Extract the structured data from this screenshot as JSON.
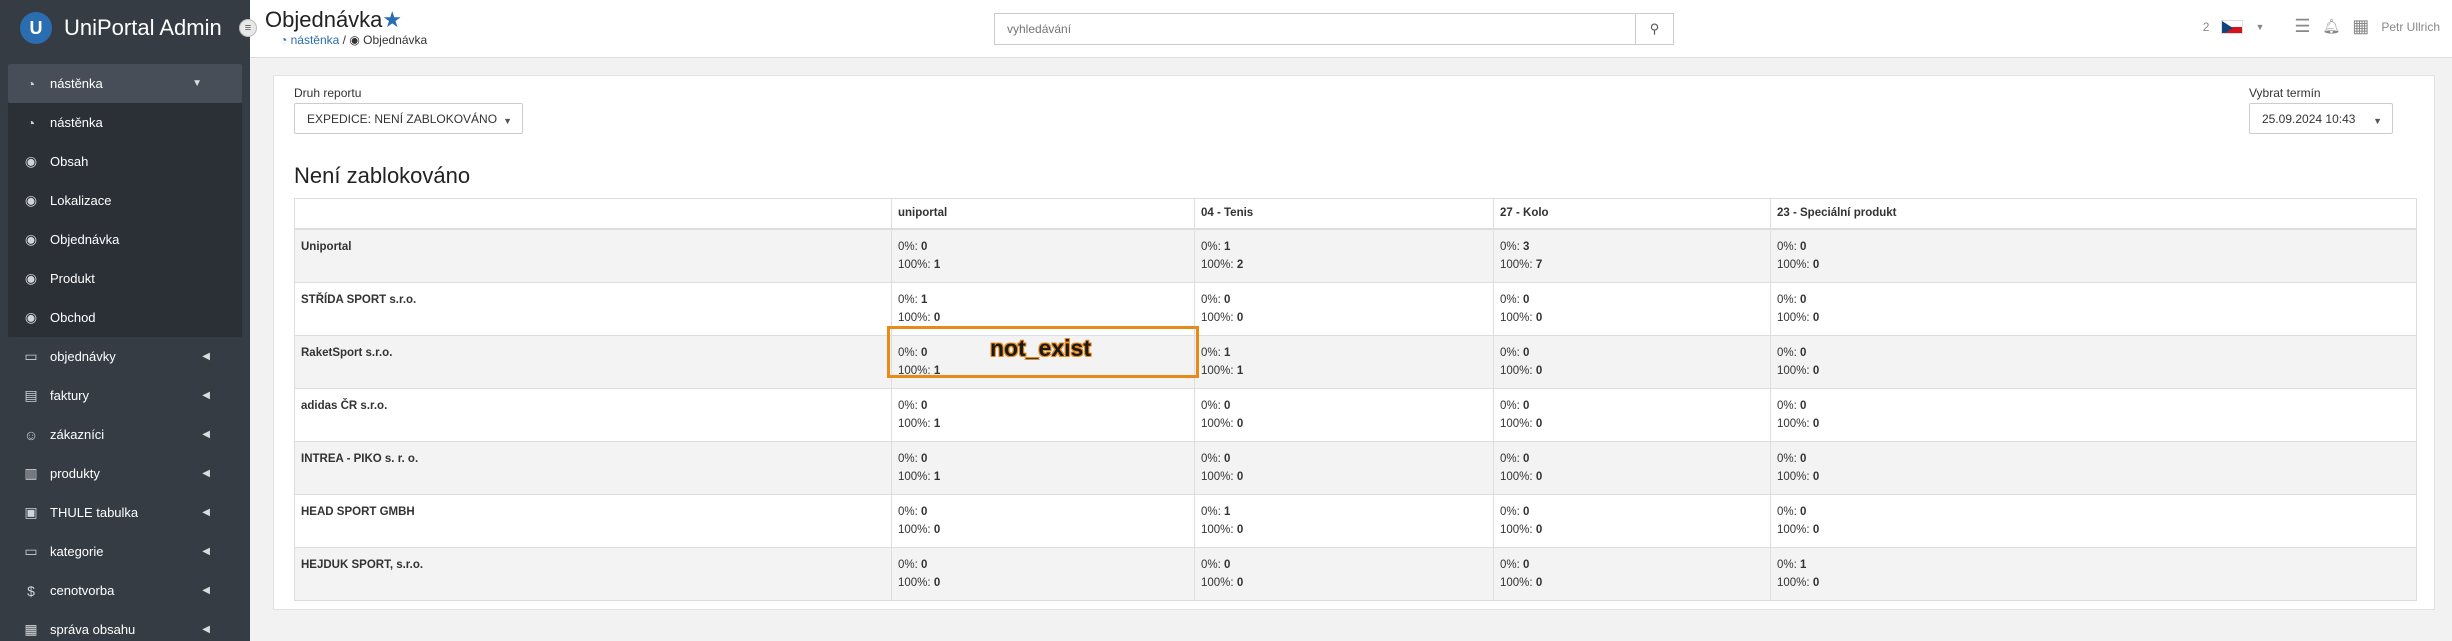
{
  "app": {
    "title": "UniPortal Admin",
    "logo_letter": "U"
  },
  "sidebar": {
    "group_head": {
      "label": "nástěnka",
      "icon": "dashboard-icon"
    },
    "group_items": [
      {
        "label": "nástěnka",
        "icon": "dashboard-icon"
      },
      {
        "label": "Obsah",
        "icon": "circle-icon"
      },
      {
        "label": "Lokalizace",
        "icon": "circle-icon"
      },
      {
        "label": "Objednávka",
        "icon": "circle-icon"
      },
      {
        "label": "Produkt",
        "icon": "circle-icon"
      },
      {
        "label": "Obchod",
        "icon": "circle-icon"
      }
    ],
    "items": [
      {
        "label": "objednávky",
        "icon": "folder-icon"
      },
      {
        "label": "faktury",
        "icon": "invoice-icon"
      },
      {
        "label": "zákazníci",
        "icon": "users-icon"
      },
      {
        "label": "produkty",
        "icon": "products-icon"
      },
      {
        "label": "THULE tabulka",
        "icon": "vr-icon"
      },
      {
        "label": "kategorie",
        "icon": "folder-icon"
      },
      {
        "label": "cenotvorba",
        "icon": "dollar-icon"
      },
      {
        "label": "správa obsahu",
        "icon": "content-icon"
      }
    ]
  },
  "header": {
    "title": "Objednávka",
    "breadcrumb": {
      "home": "nástěnka",
      "separator": "/",
      "current": "Objednávka"
    },
    "search_placeholder": "vyhledávání",
    "notifications_count": "2",
    "user_name": "Petr Ullrich"
  },
  "filters": {
    "report_type_label": "Druh reportu",
    "report_type_value": "EXPEDICE: NENÍ ZABLOKOVÁNO",
    "date_label": "Vybrat termín",
    "date_value": "25.09.2024 10:43"
  },
  "report": {
    "title": "Není zablokováno",
    "columns": [
      "",
      "uniportal",
      "04 - Tenis",
      "27 - Kolo",
      "23 - Speciální produkt"
    ],
    "prefix_0": "0%: ",
    "prefix_100": "100%: ",
    "rows": [
      {
        "name": "Uniportal",
        "cells": [
          [
            "0",
            "1"
          ],
          [
            "1",
            "2"
          ],
          [
            "3",
            "7"
          ],
          [
            "0",
            "0"
          ]
        ]
      },
      {
        "name": "STŘÍDA SPORT s.r.o.",
        "cells": [
          [
            "1",
            "0"
          ],
          [
            "0",
            "0"
          ],
          [
            "0",
            "0"
          ],
          [
            "0",
            "0"
          ]
        ]
      },
      {
        "name": "RaketSport s.r.o.",
        "cells": [
          [
            "0",
            "1"
          ],
          [
            "1",
            "1"
          ],
          [
            "0",
            "0"
          ],
          [
            "0",
            "0"
          ]
        ]
      },
      {
        "name": "adidas ČR s.r.o.",
        "cells": [
          [
            "0",
            "1"
          ],
          [
            "0",
            "0"
          ],
          [
            "0",
            "0"
          ],
          [
            "0",
            "0"
          ]
        ]
      },
      {
        "name": "INTREA - PIKO s. r. o.",
        "cells": [
          [
            "0",
            "1"
          ],
          [
            "0",
            "0"
          ],
          [
            "0",
            "0"
          ],
          [
            "0",
            "0"
          ]
        ]
      },
      {
        "name": "HEAD SPORT GMBH",
        "cells": [
          [
            "0",
            "0"
          ],
          [
            "1",
            "0"
          ],
          [
            "0",
            "0"
          ],
          [
            "0",
            "0"
          ]
        ]
      },
      {
        "name": "HEJDUK SPORT, s.r.o.",
        "cells": [
          [
            "0",
            "0"
          ],
          [
            "0",
            "0"
          ],
          [
            "0",
            "0"
          ],
          [
            "1",
            "0"
          ]
        ]
      }
    ]
  },
  "overlay": {
    "label": "not_exist",
    "color": "#e88a1a"
  }
}
